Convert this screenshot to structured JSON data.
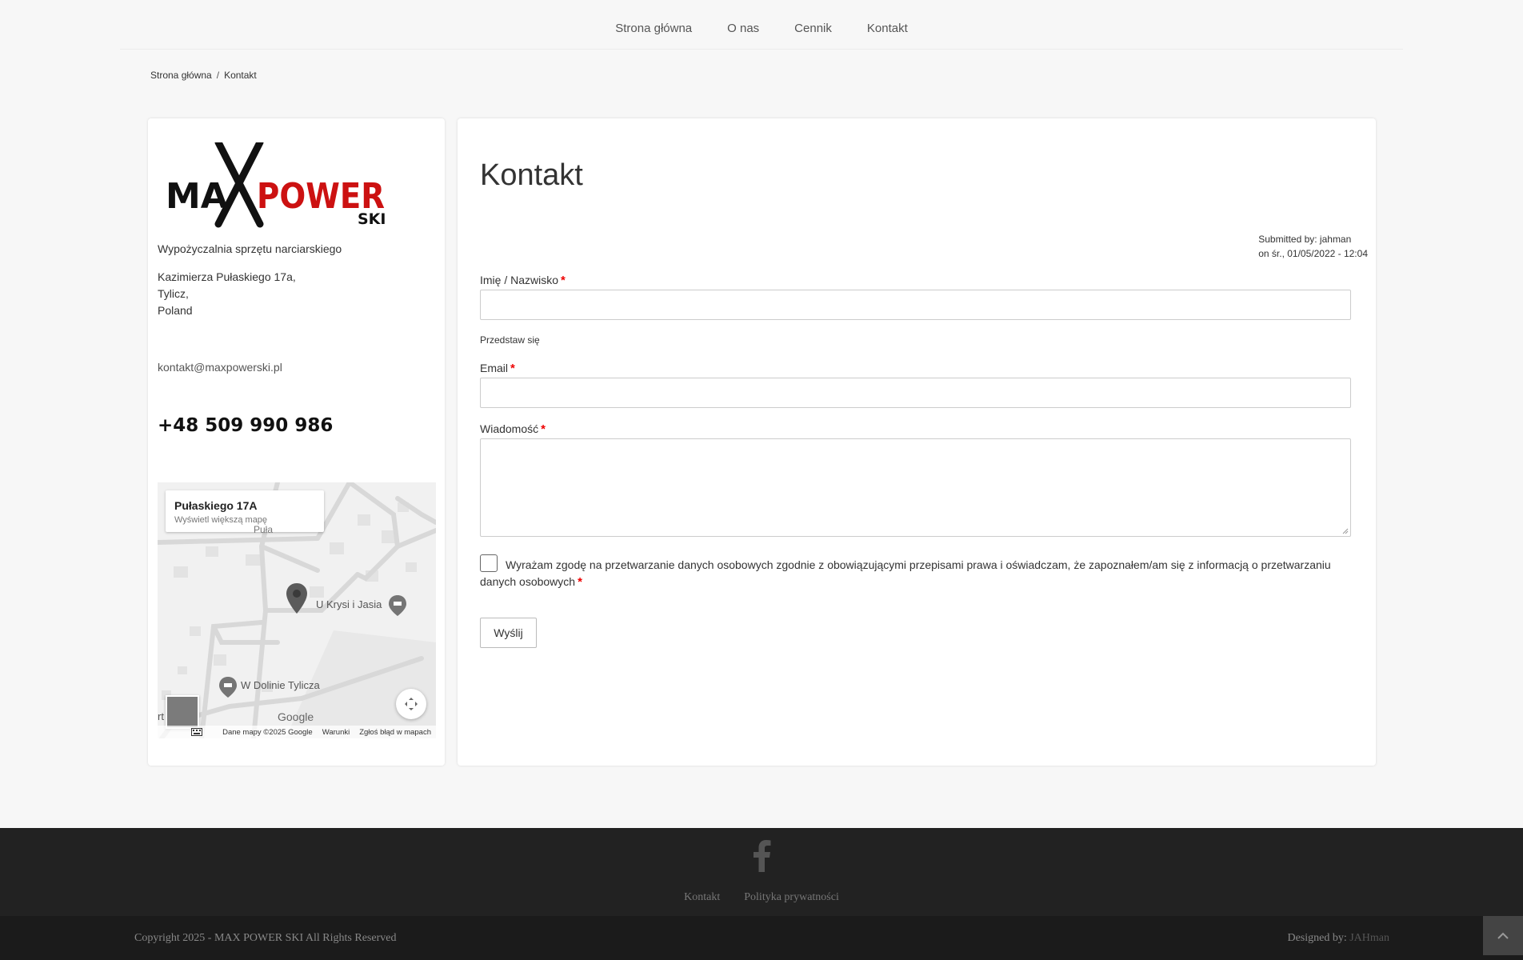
{
  "nav": {
    "items": [
      "Strona główna",
      "O nas",
      "Cennik",
      "Kontakt"
    ]
  },
  "breadcrumb": {
    "home": "Strona główna",
    "separator": "/",
    "current": "Kontakt"
  },
  "sidebar": {
    "logo": {
      "part1": "MA",
      "part2": "POWER",
      "part3": "SKI",
      "brand_black": "#111111",
      "brand_red": "#cc1111"
    },
    "tagline": "Wypożyczalnia sprzętu narciarskiego",
    "address": [
      "Kazimierza Pułaskiego 17a,",
      "Tylicz,",
      "Poland"
    ],
    "email": "kontakt@maxpowerski.pl",
    "phone": "+48 509 990 986",
    "map": {
      "place_title": "Pułaskiego 17A",
      "place_link": "Wyświetl większą mapę",
      "poi_1": "U Krysi i Jasia",
      "poi_2": "W Dolinie Tylicza",
      "fragment_left": "rt",
      "fragment_top": "Puła",
      "logo": "Google",
      "attribution": "Dane mapy ©2025 Google",
      "terms": "Warunki",
      "report": "Zgłoś błąd w mapach"
    }
  },
  "main": {
    "title": "Kontakt",
    "submitted_by": "Submitted by: jahman",
    "submitted_on": "on śr., 01/05/2022 - 12:04",
    "form": {
      "name_label": "Imię / Nazwisko",
      "name_help": "Przedstaw się",
      "email_label": "Email",
      "message_label": "Wiadomość",
      "required_marker": "*",
      "consent": "Wyrażam zgodę na przetwarzanie danych osobowych zgodnie z obowiązującymi przepisami prawa i oświadczam, że zapoznałem/am się z informacją o przetwarzaniu danych osobowych",
      "submit_label": "Wyślij"
    }
  },
  "footer": {
    "links": [
      "Kontakt",
      "Polityka prywatności"
    ],
    "copyright": "Copyright 2025 - MAX POWER SKI All Rights Reserved",
    "designed_by_label": "Designed by:",
    "designer": "JAHman"
  }
}
